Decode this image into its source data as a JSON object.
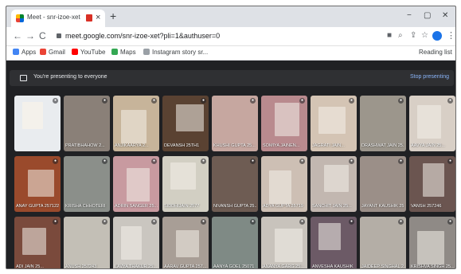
{
  "browser": {
    "tab_title": "Meet - snr-izoe-xet",
    "tab_close": "×",
    "new_tab": "+",
    "win_min": "−",
    "win_max": "▢",
    "win_close": "✕",
    "back": "←",
    "forward": "→",
    "reload": "C",
    "url": "meet.google.com/snr-izoe-xet?pli=1&authuser=0",
    "camera_icon_glyph": "■",
    "zoom_icon_glyph": "⌕",
    "share_icon_glyph": "⇪",
    "star_icon_glyph": "☆",
    "kebab_glyph": "⋮"
  },
  "bookmarks": [
    {
      "label": "Apps",
      "color": "#4285f4"
    },
    {
      "label": "Gmail",
      "color": "#ea4335"
    },
    {
      "label": "YouTube",
      "color": "#ff0000"
    },
    {
      "label": "Maps",
      "color": "#34a853"
    },
    {
      "label": "Instagram story sr...",
      "color": "#9aa0a6"
    }
  ],
  "reading_list": "Reading list",
  "meet": {
    "banner_text": "You're presenting to everyone",
    "stop_label": "Stop presenting"
  },
  "participants": [
    {
      "name": "",
      "bg": "#e9ecef"
    },
    {
      "name": "PRATIBHAHOW 2...",
      "bg": "#8a8078"
    },
    {
      "name": "ANJIKAARYA 2...",
      "bg": "#c7b49a"
    },
    {
      "name": "DEVANSH 25TH1",
      "bg": "#5a4232"
    },
    {
      "name": "KHUSHI GUPTA 25...",
      "bg": "#c6a7a0"
    },
    {
      "name": "SOMIYA JAINEN...",
      "bg": "#b98a8e"
    },
    {
      "name": "JAGRATI JAIN...",
      "bg": "#d4c4b4"
    },
    {
      "name": "DRASHWAT JAIN 25...",
      "bg": "#9c968c"
    },
    {
      "name": "AAVYA JAIN 25...",
      "bg": "#d8cfc6"
    },
    {
      "name": "ANAY GUPTA 257122",
      "bg": "#9a4a2c"
    },
    {
      "name": "KRISHA CHHOTERI",
      "bg": "#8b8f8a"
    },
    {
      "name": "ADRIN SANGER 25...",
      "bg": "#c89aa0"
    },
    {
      "name": "SIDDHIJAIN 2577",
      "bg": "#d2cfc3"
    },
    {
      "name": "NIVANSH GUPTA 25...",
      "bg": "#6e5c53"
    },
    {
      "name": "ADYA GUPTA 25719",
      "bg": "#cdbfb4"
    },
    {
      "name": "SANCHIT JAIN 25...",
      "bg": "#c2b7b0"
    },
    {
      "name": "JAYANT KAUSHIK 25...",
      "bg": "#9b8f88"
    },
    {
      "name": "VANSH 257246",
      "bg": "#6b5550"
    },
    {
      "name": "ADI JAIN 25...",
      "bg": "#7a4a3c"
    },
    {
      "name": "ANUSH 257243",
      "bg": "#c3bfb6"
    },
    {
      "name": "LAVYA THAKUR 25...",
      "bg": "#cac6c0"
    },
    {
      "name": "AARAV GUPTA 257...",
      "bg": "#a89e96"
    },
    {
      "name": "AANYA GOEL 25071",
      "bg": "#7f8a85"
    },
    {
      "name": "ANANYA GARG 25...",
      "bg": "#c8c3bc"
    },
    {
      "name": "ANVESHA KAUSHIK",
      "bg": "#6c5a66"
    },
    {
      "name": "JAIDEEP SINGHAL 2...",
      "bg": "#b4aea6"
    },
    {
      "name": "KRISHVA SINGH 25...",
      "bg": "#8f8a86"
    }
  ]
}
